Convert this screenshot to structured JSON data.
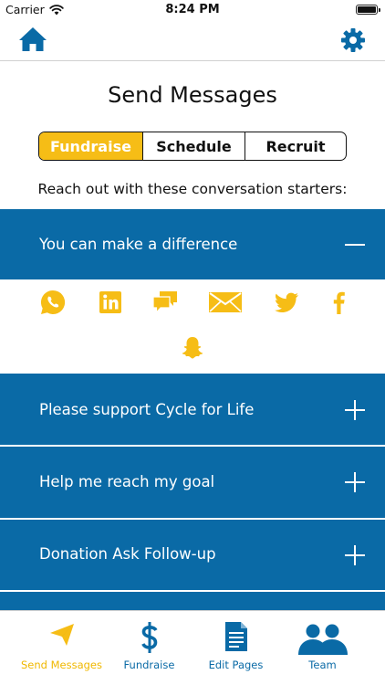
{
  "status_bar": {
    "carrier": "Carrier",
    "time": "8:24 PM"
  },
  "page": {
    "title": "Send Messages",
    "intro": "Reach out with these conversation starters:"
  },
  "segments": [
    {
      "label": "Fundraise",
      "active": true
    },
    {
      "label": "Schedule",
      "active": false
    },
    {
      "label": "Recruit",
      "active": false
    }
  ],
  "accordion": [
    {
      "title": "You can make a difference",
      "expanded": true
    },
    {
      "title": "Please support Cycle for Life",
      "expanded": false
    },
    {
      "title": "Help me reach my goal",
      "expanded": false
    },
    {
      "title": "Donation Ask Follow-up",
      "expanded": false
    }
  ],
  "share_icons": [
    "whatsapp-icon",
    "linkedin-icon",
    "sms-icon",
    "email-icon",
    "twitter-icon",
    "facebook-icon",
    "snapchat-icon"
  ],
  "tabs": [
    {
      "label": "Send Messages",
      "icon": "paper-plane-icon",
      "active": true
    },
    {
      "label": "Fundraise",
      "icon": "dollar-icon",
      "active": false
    },
    {
      "label": "Edit Pages",
      "icon": "document-icon",
      "active": false
    },
    {
      "label": "Team",
      "icon": "team-icon",
      "active": false
    }
  ],
  "colors": {
    "primary_blue": "#0a6aa6",
    "accent_yellow": "#f6bd16",
    "tab_active": "#f0b800"
  }
}
